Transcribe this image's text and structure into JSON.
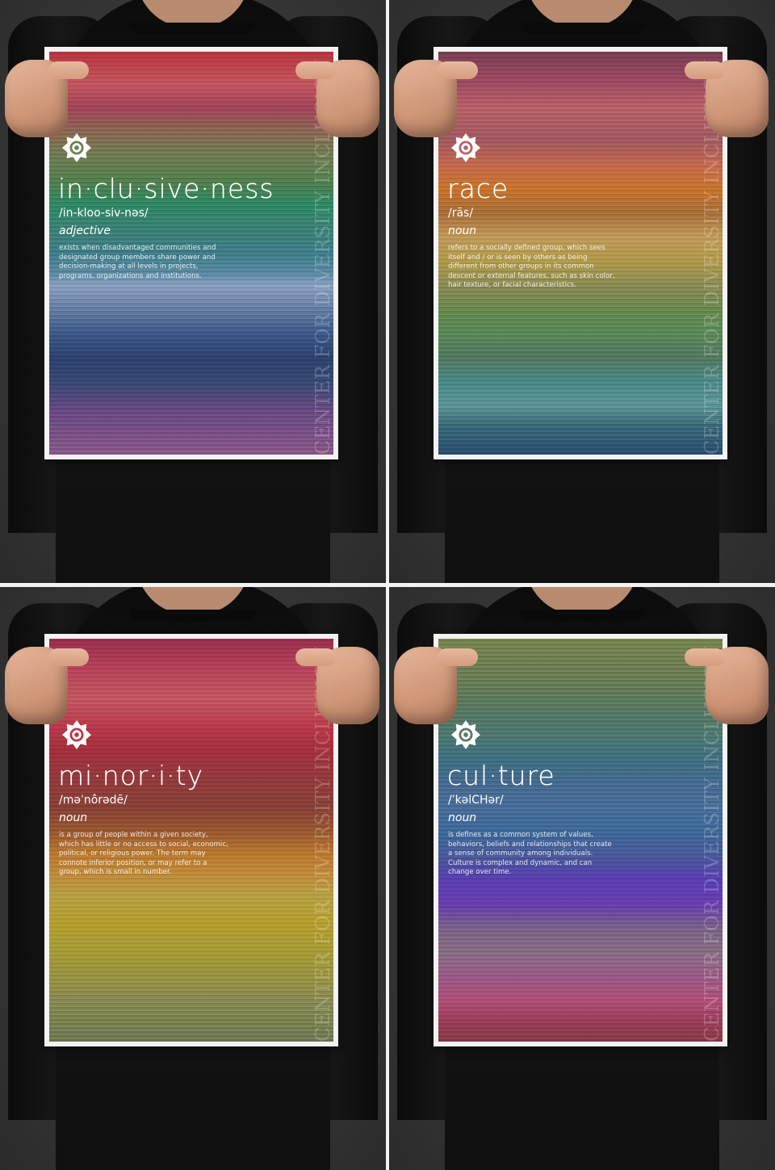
{
  "vertical_text": "CENTER FOR DIVERSITY INCLUSION",
  "logo_icon": "sun-target-icon",
  "posters": [
    {
      "word": "in·clu·sive·ness",
      "pronunciation": "/in-kloo-siv-nəs/",
      "part_of_speech": "adjective",
      "definition": "exists when disadvantaged communities and designated group members share power and decision-making at all levels in projects, programs, organizations and institutions.",
      "colors": [
        "#b8363f",
        "#c2575f",
        "#a3455a",
        "#8a6a55",
        "#6f7e52",
        "#55804f",
        "#2e8a66",
        "#3d8378",
        "#3f7f8a",
        "#5b8aa2",
        "#8aa0be",
        "#6d84a8",
        "#3d5a8a",
        "#2f4370",
        "#384a76",
        "#6a4a85",
        "#8a5a8a"
      ]
    },
    {
      "word": "race",
      "pronunciation": "/rās/",
      "part_of_speech": "noun",
      "definition": "refers to a socially defined group, which sees itself and / or is seen by others as being different from other groups in its common descent or external features, such as skin color, hair texture, or facial characteristics.",
      "colors": [
        "#7a3e55",
        "#9c4a62",
        "#b8626a",
        "#a25a62",
        "#c36a4f",
        "#c8752c",
        "#a8703a",
        "#bf9a5a",
        "#b09a4a",
        "#8c8c55",
        "#6a8a4f",
        "#5b8a5a",
        "#547a62",
        "#4a8a86",
        "#5d9598",
        "#3b6a7a",
        "#2c4f70"
      ]
    },
    {
      "word": "mi·nor·i·ty",
      "pronunciation": "/məˈnôrədē/",
      "part_of_speech": "noun",
      "definition": "is a group of people within a given society, which has little or no access to social, economic, political, or religious power. The term may connote inferior position, or may refer to a group, which is small in number.",
      "colors": [
        "#9a2f4e",
        "#b8455d",
        "#c25960",
        "#b83a4a",
        "#a4303e",
        "#963a3e",
        "#8a4238",
        "#9a5a32",
        "#b8782e",
        "#c08a3a",
        "#b6a044",
        "#b59f30",
        "#a69b36",
        "#9a9342",
        "#8a8a55",
        "#7a8550",
        "#6f7a55"
      ]
    },
    {
      "word": "cul·ture",
      "pronunciation": "/ˈkəlCHər/",
      "part_of_speech": "noun",
      "definition": "is defines as a common system of values, behaviors, beliefs and relationships that create a sense of community among individuals. Culture is complex and dynamic, and can change over time.",
      "colors": [
        "#7a8650",
        "#6b7e55",
        "#5a7a62",
        "#4f7a72",
        "#3f7082",
        "#476c92",
        "#4a6f9a",
        "#3e6a9a",
        "#4a5a9a",
        "#5a3fb2",
        "#6a3fae",
        "#7a6488",
        "#8a6f86",
        "#9a5a86",
        "#b04e78",
        "#9a3f5a",
        "#8a3a4a"
      ]
    }
  ]
}
